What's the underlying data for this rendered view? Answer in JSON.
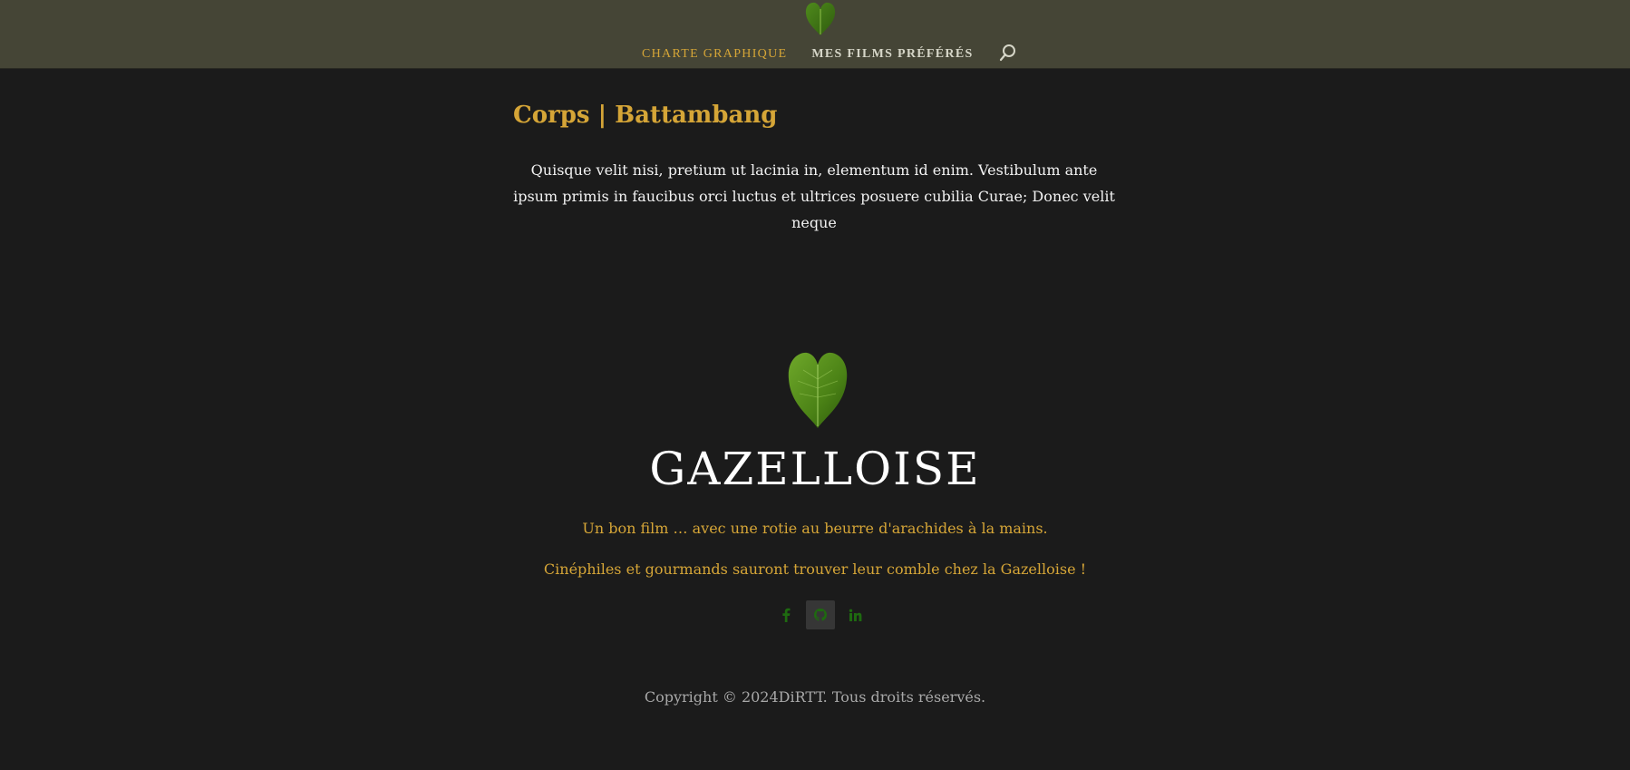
{
  "header": {
    "nav": [
      {
        "label": "CHARTE GRAPHIQUE",
        "active": true
      },
      {
        "label": "MES FILMS PRÉFÉRÉS",
        "active": false
      }
    ],
    "search_icon": "search-icon",
    "logo_icon": "leaf-heart-icon"
  },
  "main": {
    "title": "Corps | Battambang",
    "body": "Quisque velit nisi, pretium ut lacinia in, elementum id enim. Vestibulum ante ipsum primis in faucibus orci luctus et ultrices posuere cubilia Curae; Donec velit neque"
  },
  "footer": {
    "brand": "GAZELLOISE",
    "tagline_1": "Un bon film … avec une rotie au beurre d'arachides à la mains.",
    "tagline_2": "Cinéphiles et gourmands sauront trouver leur comble chez la Gazelloise !",
    "social": [
      {
        "icon": "facebook-icon"
      },
      {
        "icon": "github-icon"
      },
      {
        "icon": "linkedin-icon"
      }
    ],
    "copyright": "Copyright © 2024DiRTT. Tous droits réservés."
  },
  "colors": {
    "header_bg": "#454536",
    "page_bg": "#1b1b1b",
    "accent": "#d5a537",
    "social_icon": "#1e6a10"
  }
}
